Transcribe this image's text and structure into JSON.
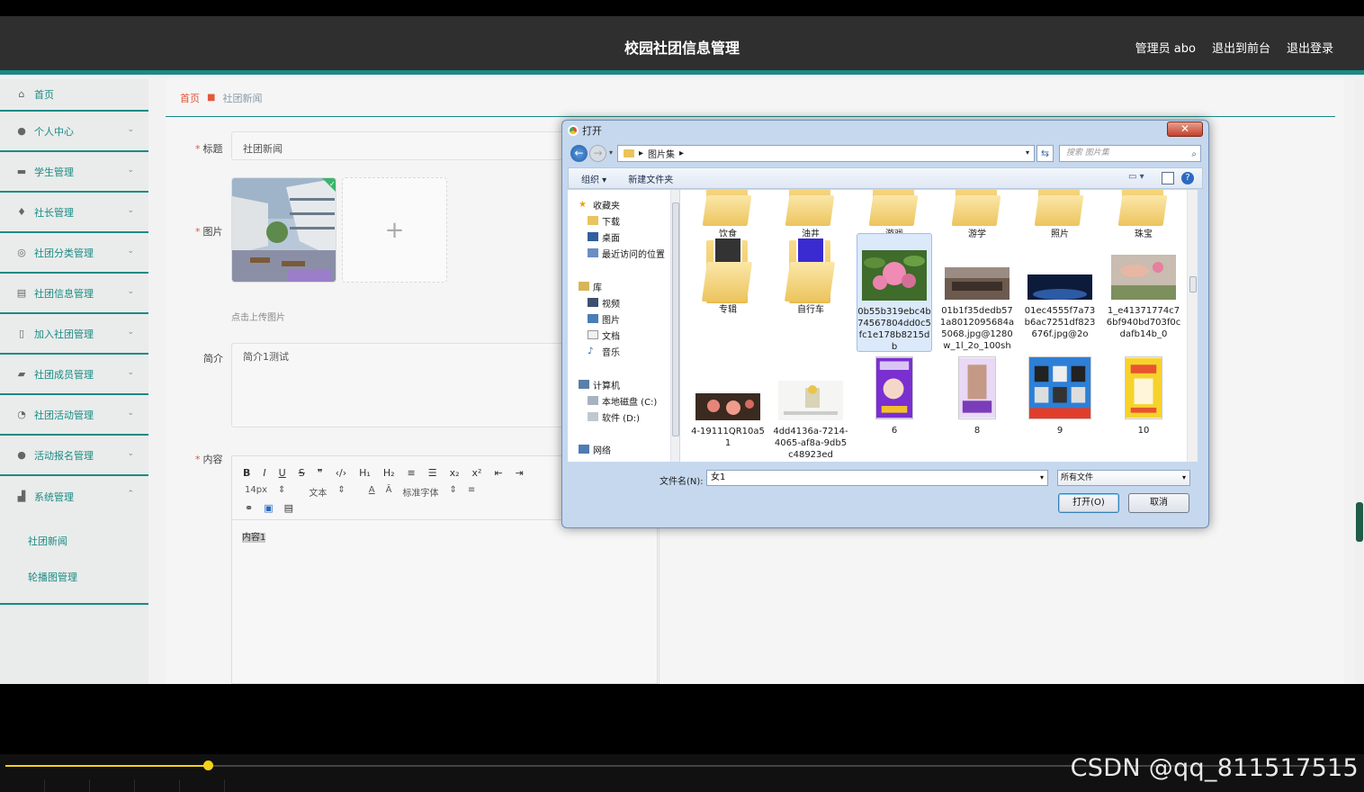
{
  "app": {
    "title": "校园社团信息管理",
    "nav": [
      "管理员 abo",
      "退出到前台",
      "退出登录"
    ]
  },
  "sidebar": {
    "items": [
      {
        "label": "首页",
        "icon": "home-icon"
      },
      {
        "label": "个人中心",
        "icon": "user-icon"
      },
      {
        "label": "学生管理",
        "icon": "briefcase-icon"
      },
      {
        "label": "社长管理",
        "icon": "microphone-icon"
      },
      {
        "label": "社团分类管理",
        "icon": "circle-icon"
      },
      {
        "label": "社团信息管理",
        "icon": "document-icon"
      },
      {
        "label": "加入社团管理",
        "icon": "phone-icon"
      },
      {
        "label": "社团成员管理",
        "icon": "chat-icon"
      },
      {
        "label": "社团活动管理",
        "icon": "gauge-icon"
      },
      {
        "label": "活动报名管理",
        "icon": "pin-icon"
      },
      {
        "label": "系统管理",
        "icon": "chart-icon"
      }
    ],
    "subitems": [
      "社团新闻",
      "轮播图管理"
    ]
  },
  "breadcrumb": {
    "home": "首页",
    "current": "社团新闻"
  },
  "form": {
    "title_label": "标题",
    "title_value": "社团新闻",
    "image_label": "图片",
    "image_hint": "点击上传图片",
    "intro_label": "简介",
    "intro_value": "简介1测试",
    "content_label": "内容",
    "content_value": "内容1"
  },
  "editor": {
    "buttons": [
      "B",
      "I",
      "U",
      "S",
      "❞",
      "‹/›",
      "H₁",
      "H₂",
      "≡",
      "☰",
      "x₂",
      "x²",
      "⇤",
      "⇥"
    ],
    "font_size": "14px",
    "paragraph": "文本",
    "font_family": "标准字体"
  },
  "dialog": {
    "title": "打开",
    "close": "✕",
    "address": [
      "图片集"
    ],
    "search_placeholder": "搜索 图片集",
    "organize": "组织 ▾",
    "new_folder": "新建文件夹",
    "nav": {
      "favorites": "收藏夹",
      "downloads": "下载",
      "desktop": "桌面",
      "recent": "最近访问的位置",
      "libraries": "库",
      "videos": "视频",
      "pictures": "图片",
      "documents": "文档",
      "music": "音乐",
      "computer": "计算机",
      "local_disk": "本地磁盘 (C:)",
      "software": "软件 (D:)",
      "network": "网络"
    },
    "files": [
      {
        "name": "饮食",
        "type": "folder"
      },
      {
        "name": "油井",
        "type": "folder"
      },
      {
        "name": "游戏",
        "type": "folder"
      },
      {
        "name": "游学",
        "type": "folder"
      },
      {
        "name": "照片",
        "type": "folder"
      },
      {
        "name": "珠宝",
        "type": "folder"
      },
      {
        "name": "专辑",
        "type": "folder"
      },
      {
        "name": "自行车",
        "type": "folder"
      },
      {
        "name": "0b55b319ebc4b74567804dd0c5fc1e178b8215db",
        "type": "image"
      },
      {
        "name": "01b1f35dedb571a8012095684a5068.jpg@1280w_1l_2o_100sh",
        "type": "image"
      },
      {
        "name": "01ec4555f7a73b6ac7251df823676f.jpg@2o",
        "type": "image"
      },
      {
        "name": "1_e41371774c76bf940bd703f0cdafb14b_0",
        "type": "image"
      },
      {
        "name": "4-19111QR10a51",
        "type": "image"
      },
      {
        "name": "4dd4136a-7214-4065-af8a-9db5c48923ed",
        "type": "image"
      },
      {
        "name": "6",
        "type": "image"
      },
      {
        "name": "8",
        "type": "image"
      },
      {
        "name": "9",
        "type": "image"
      },
      {
        "name": "10",
        "type": "image"
      }
    ],
    "filename_label": "文件名(N):",
    "filename_value": "女1",
    "filetype": "所有文件",
    "open_button": "打开(O)",
    "cancel_button": "取消"
  },
  "player": {
    "progress": 0.15
  },
  "watermark": "CSDN @qq_811517515"
}
